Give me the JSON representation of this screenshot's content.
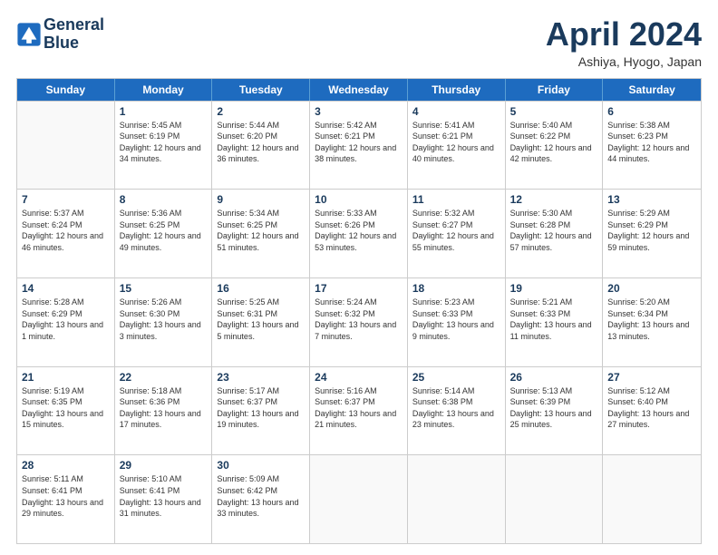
{
  "logo": {
    "line1": "General",
    "line2": "Blue"
  },
  "header": {
    "month": "April 2024",
    "location": "Ashiya, Hyogo, Japan"
  },
  "weekdays": [
    "Sunday",
    "Monday",
    "Tuesday",
    "Wednesday",
    "Thursday",
    "Friday",
    "Saturday"
  ],
  "weeks": [
    [
      {
        "day": "",
        "sunrise": "",
        "sunset": "",
        "daylight": ""
      },
      {
        "day": "1",
        "sunrise": "Sunrise: 5:45 AM",
        "sunset": "Sunset: 6:19 PM",
        "daylight": "Daylight: 12 hours and 34 minutes."
      },
      {
        "day": "2",
        "sunrise": "Sunrise: 5:44 AM",
        "sunset": "Sunset: 6:20 PM",
        "daylight": "Daylight: 12 hours and 36 minutes."
      },
      {
        "day": "3",
        "sunrise": "Sunrise: 5:42 AM",
        "sunset": "Sunset: 6:21 PM",
        "daylight": "Daylight: 12 hours and 38 minutes."
      },
      {
        "day": "4",
        "sunrise": "Sunrise: 5:41 AM",
        "sunset": "Sunset: 6:21 PM",
        "daylight": "Daylight: 12 hours and 40 minutes."
      },
      {
        "day": "5",
        "sunrise": "Sunrise: 5:40 AM",
        "sunset": "Sunset: 6:22 PM",
        "daylight": "Daylight: 12 hours and 42 minutes."
      },
      {
        "day": "6",
        "sunrise": "Sunrise: 5:38 AM",
        "sunset": "Sunset: 6:23 PM",
        "daylight": "Daylight: 12 hours and 44 minutes."
      }
    ],
    [
      {
        "day": "7",
        "sunrise": "Sunrise: 5:37 AM",
        "sunset": "Sunset: 6:24 PM",
        "daylight": "Daylight: 12 hours and 46 minutes."
      },
      {
        "day": "8",
        "sunrise": "Sunrise: 5:36 AM",
        "sunset": "Sunset: 6:25 PM",
        "daylight": "Daylight: 12 hours and 49 minutes."
      },
      {
        "day": "9",
        "sunrise": "Sunrise: 5:34 AM",
        "sunset": "Sunset: 6:25 PM",
        "daylight": "Daylight: 12 hours and 51 minutes."
      },
      {
        "day": "10",
        "sunrise": "Sunrise: 5:33 AM",
        "sunset": "Sunset: 6:26 PM",
        "daylight": "Daylight: 12 hours and 53 minutes."
      },
      {
        "day": "11",
        "sunrise": "Sunrise: 5:32 AM",
        "sunset": "Sunset: 6:27 PM",
        "daylight": "Daylight: 12 hours and 55 minutes."
      },
      {
        "day": "12",
        "sunrise": "Sunrise: 5:30 AM",
        "sunset": "Sunset: 6:28 PM",
        "daylight": "Daylight: 12 hours and 57 minutes."
      },
      {
        "day": "13",
        "sunrise": "Sunrise: 5:29 AM",
        "sunset": "Sunset: 6:29 PM",
        "daylight": "Daylight: 12 hours and 59 minutes."
      }
    ],
    [
      {
        "day": "14",
        "sunrise": "Sunrise: 5:28 AM",
        "sunset": "Sunset: 6:29 PM",
        "daylight": "Daylight: 13 hours and 1 minute."
      },
      {
        "day": "15",
        "sunrise": "Sunrise: 5:26 AM",
        "sunset": "Sunset: 6:30 PM",
        "daylight": "Daylight: 13 hours and 3 minutes."
      },
      {
        "day": "16",
        "sunrise": "Sunrise: 5:25 AM",
        "sunset": "Sunset: 6:31 PM",
        "daylight": "Daylight: 13 hours and 5 minutes."
      },
      {
        "day": "17",
        "sunrise": "Sunrise: 5:24 AM",
        "sunset": "Sunset: 6:32 PM",
        "daylight": "Daylight: 13 hours and 7 minutes."
      },
      {
        "day": "18",
        "sunrise": "Sunrise: 5:23 AM",
        "sunset": "Sunset: 6:33 PM",
        "daylight": "Daylight: 13 hours and 9 minutes."
      },
      {
        "day": "19",
        "sunrise": "Sunrise: 5:21 AM",
        "sunset": "Sunset: 6:33 PM",
        "daylight": "Daylight: 13 hours and 11 minutes."
      },
      {
        "day": "20",
        "sunrise": "Sunrise: 5:20 AM",
        "sunset": "Sunset: 6:34 PM",
        "daylight": "Daylight: 13 hours and 13 minutes."
      }
    ],
    [
      {
        "day": "21",
        "sunrise": "Sunrise: 5:19 AM",
        "sunset": "Sunset: 6:35 PM",
        "daylight": "Daylight: 13 hours and 15 minutes."
      },
      {
        "day": "22",
        "sunrise": "Sunrise: 5:18 AM",
        "sunset": "Sunset: 6:36 PM",
        "daylight": "Daylight: 13 hours and 17 minutes."
      },
      {
        "day": "23",
        "sunrise": "Sunrise: 5:17 AM",
        "sunset": "Sunset: 6:37 PM",
        "daylight": "Daylight: 13 hours and 19 minutes."
      },
      {
        "day": "24",
        "sunrise": "Sunrise: 5:16 AM",
        "sunset": "Sunset: 6:37 PM",
        "daylight": "Daylight: 13 hours and 21 minutes."
      },
      {
        "day": "25",
        "sunrise": "Sunrise: 5:14 AM",
        "sunset": "Sunset: 6:38 PM",
        "daylight": "Daylight: 13 hours and 23 minutes."
      },
      {
        "day": "26",
        "sunrise": "Sunrise: 5:13 AM",
        "sunset": "Sunset: 6:39 PM",
        "daylight": "Daylight: 13 hours and 25 minutes."
      },
      {
        "day": "27",
        "sunrise": "Sunrise: 5:12 AM",
        "sunset": "Sunset: 6:40 PM",
        "daylight": "Daylight: 13 hours and 27 minutes."
      }
    ],
    [
      {
        "day": "28",
        "sunrise": "Sunrise: 5:11 AM",
        "sunset": "Sunset: 6:41 PM",
        "daylight": "Daylight: 13 hours and 29 minutes."
      },
      {
        "day": "29",
        "sunrise": "Sunrise: 5:10 AM",
        "sunset": "Sunset: 6:41 PM",
        "daylight": "Daylight: 13 hours and 31 minutes."
      },
      {
        "day": "30",
        "sunrise": "Sunrise: 5:09 AM",
        "sunset": "Sunset: 6:42 PM",
        "daylight": "Daylight: 13 hours and 33 minutes."
      },
      {
        "day": "",
        "sunrise": "",
        "sunset": "",
        "daylight": ""
      },
      {
        "day": "",
        "sunrise": "",
        "sunset": "",
        "daylight": ""
      },
      {
        "day": "",
        "sunrise": "",
        "sunset": "",
        "daylight": ""
      },
      {
        "day": "",
        "sunrise": "",
        "sunset": "",
        "daylight": ""
      }
    ]
  ]
}
